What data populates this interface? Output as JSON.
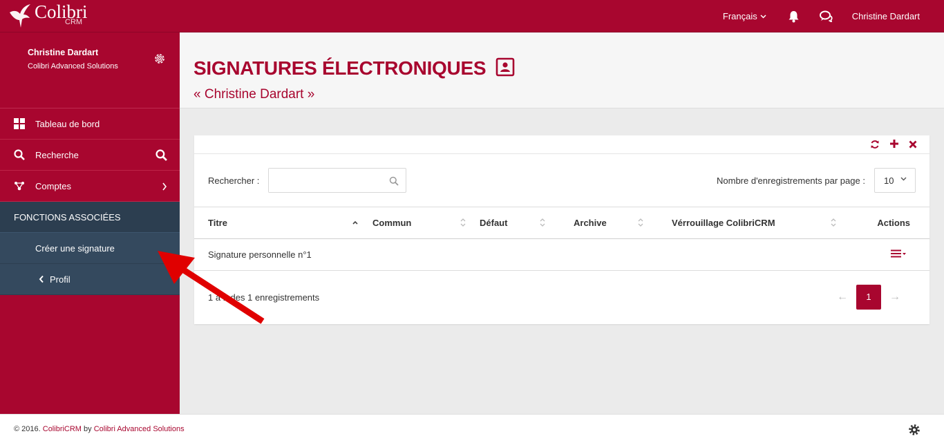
{
  "header": {
    "logo_text": "Colibri",
    "logo_sub": "CRM",
    "language": "Français",
    "user": "Christine Dardart"
  },
  "sidebar": {
    "profile_name": "Christine Dardart",
    "profile_company": "Colibri Advanced Solutions",
    "items": [
      {
        "label": "Tableau de bord",
        "icon": "dashboard-icon"
      },
      {
        "label": "Recherche",
        "icon": "search-icon"
      },
      {
        "label": "Comptes",
        "icon": "accounts-icon"
      }
    ],
    "section_title": "FONCTIONS ASSOCIÉES",
    "section_items": [
      {
        "label": "Créer une signature"
      },
      {
        "label": "Profil"
      }
    ]
  },
  "page": {
    "title": "SIGNATURES ÉLECTRONIQUES",
    "subtitle": "« Christine Dardart »"
  },
  "table_controls": {
    "search_label": "Rechercher :",
    "search_value": "",
    "perpage_label": "Nombre d'enregistrements par page :",
    "perpage_value": "10"
  },
  "table": {
    "columns": [
      "Titre",
      "Commun",
      "Défaut",
      "Archive",
      "Vérrouillage ColibriCRM",
      "Actions"
    ],
    "rows": [
      {
        "titre": "Signature personnelle n°1",
        "commun": "",
        "defaut": "",
        "archive": "",
        "verrouillage": ""
      }
    ],
    "info": "1 à 1 des 1 enregistrements",
    "pages": [
      "1"
    ],
    "prev": "←",
    "next": "→"
  },
  "footer": {
    "prefix": "© 2016. ",
    "brand": "ColibriCRM",
    "by": " by ",
    "company": "Colibri Advanced Solutions"
  },
  "colors": {
    "brand": "#a8062f",
    "sidebar_section": "#34495e",
    "annotation_arrow": "#e00000"
  }
}
